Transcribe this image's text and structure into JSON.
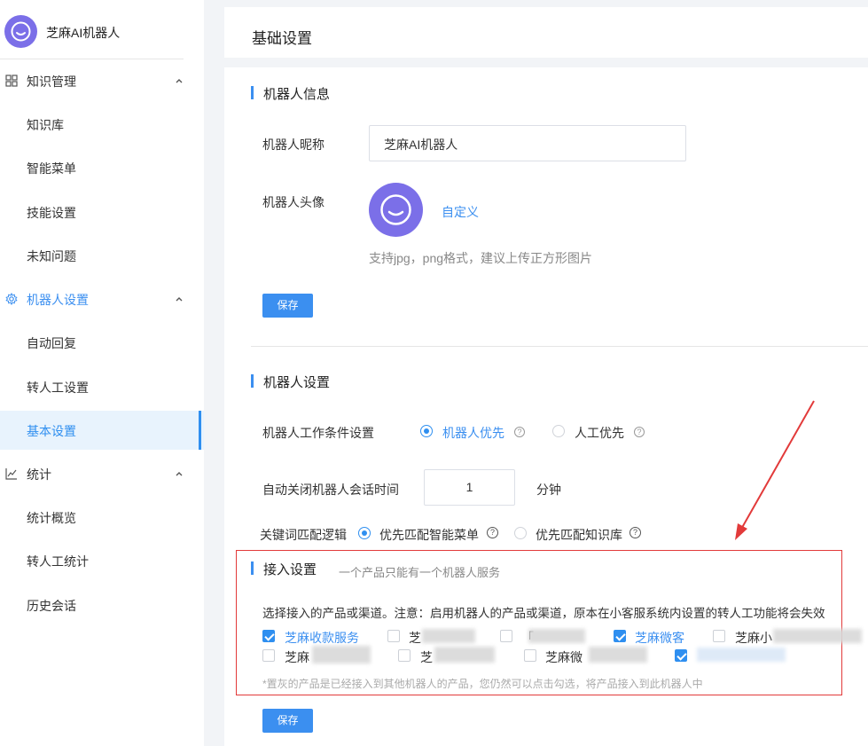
{
  "brand": {
    "name": "芝麻AI机器人"
  },
  "sidebar": {
    "groups": [
      {
        "label": "知识管理",
        "icon": "grid-icon",
        "items": [
          "知识库",
          "智能菜单",
          "技能设置",
          "未知问题"
        ]
      },
      {
        "label": "机器人设置",
        "icon": "gear-icon",
        "items": [
          "自动回复",
          "转人工设置",
          "基本设置"
        ]
      },
      {
        "label": "统计",
        "icon": "line-chart-icon",
        "items": [
          "统计概览",
          "转人工统计",
          "历史会话"
        ]
      }
    ],
    "active_item": "基本设置"
  },
  "page": {
    "title": "基础设置"
  },
  "robot_info": {
    "title": "机器人信息",
    "nickname_label": "机器人昵称",
    "nickname_value": "芝麻AI机器人",
    "avatar_label": "机器人头像",
    "customize_link": "自定义",
    "avatar_hint": "支持jpg，png格式，建议上传正方形图片",
    "save": "保存"
  },
  "robot_settings": {
    "title": "机器人设置",
    "work_label": "机器人工作条件设置",
    "work_options": [
      "机器人优先",
      "人工优先"
    ],
    "auto_close_label": "自动关闭机器人会话时间",
    "auto_close_value": "1",
    "auto_close_unit": "分钟",
    "keyword_label": "关键词匹配逻辑",
    "keyword_options": [
      "优先匹配智能菜单",
      "优先匹配知识库"
    ]
  },
  "access": {
    "title": "接入设置",
    "subtitle": "一个产品只能有一个机器人服务",
    "notice": "选择接入的产品或渠道。注意：启用机器人的产品或渠道，原本在小客服系统内设置的转人工功能将会失效",
    "products_row1": [
      {
        "label": "芝麻收款服务",
        "checked": true
      },
      {
        "label": "芝",
        "checked": false
      },
      {
        "label": "「",
        "checked": false
      },
      {
        "label": "芝麻微客",
        "checked": true
      },
      {
        "label": "芝麻小",
        "checked": false
      }
    ],
    "products_row2": [
      {
        "label": "芝麻",
        "checked": false
      },
      {
        "label": "芝",
        "checked": false
      },
      {
        "label": "芝麻微",
        "checked": false
      },
      {
        "label": "",
        "checked": true
      }
    ],
    "gray_hint": "*置灰的产品是已经接入到其他机器人的产品，您仍然可以点击勾选，将产品接入到此机器人中",
    "save": "保存"
  },
  "colors": {
    "accent": "#3b8ff0",
    "brand": "#7b6fe8",
    "annotation": "#e23a3a"
  }
}
